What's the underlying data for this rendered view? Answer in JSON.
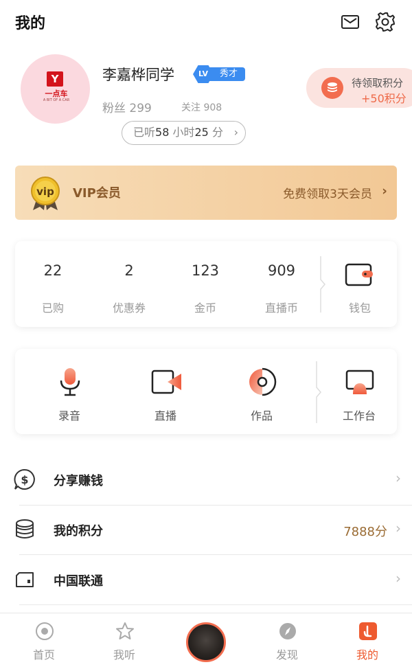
{
  "header": {
    "title": "我的"
  },
  "profile": {
    "avatar_brand": "一点车",
    "avatar_logo_char": "Y",
    "avatar_tagline": "A BIT OF A CAR",
    "username": "李嘉桦同学",
    "level_badge": "LV",
    "level_title": "秀才",
    "fans_label": "粉丝",
    "fans_count": "299",
    "follow_label": "关注",
    "follow_count": "908",
    "listen_prefix": "已听",
    "listen_hours": "58",
    "listen_hours_unit": "小时",
    "listen_minutes": "25",
    "listen_minutes_unit": "分"
  },
  "points_pill": {
    "label": "待领取积分",
    "value": "+50积分"
  },
  "vip": {
    "medal_text": "vip",
    "label": "VIP会员",
    "promo": "免费领取3天会员"
  },
  "stats": [
    {
      "value": "22",
      "label": "已购"
    },
    {
      "value": "2",
      "label": "优惠券"
    },
    {
      "value": "123",
      "label": "金币"
    },
    {
      "value": "909",
      "label": "直播币"
    }
  ],
  "wallet": {
    "label": "钱包",
    "icon": "wallet-icon"
  },
  "tools": [
    {
      "label": "录音",
      "icon": "microphone-icon"
    },
    {
      "label": "直播",
      "icon": "video-camera-icon"
    },
    {
      "label": "作品",
      "icon": "disc-icon"
    }
  ],
  "workbench": {
    "label": "工作台",
    "icon": "monitor-icon"
  },
  "list": [
    {
      "label": "分享赚钱",
      "value": "",
      "icon": "dollar-bubble-icon"
    },
    {
      "label": "我的积分",
      "value": "7888分",
      "icon": "coin-stack-icon"
    },
    {
      "label": "中国联通",
      "value": "",
      "icon": "sim-card-icon"
    }
  ],
  "bottom_nav": [
    {
      "label": "首页",
      "icon": "home-circle-icon",
      "active": false
    },
    {
      "label": "我听",
      "icon": "star-icon",
      "active": false
    },
    {
      "label": "",
      "icon": "player-disc",
      "active": false
    },
    {
      "label": "发现",
      "icon": "compass-icon",
      "active": false
    },
    {
      "label": "我的",
      "icon": "my-profile-icon",
      "active": true
    }
  ],
  "colors": {
    "accent": "#ee5a2f",
    "vip_text": "#8a5a2b",
    "level_blue": "#3b8cf0",
    "points_value": "#9a6b33"
  }
}
